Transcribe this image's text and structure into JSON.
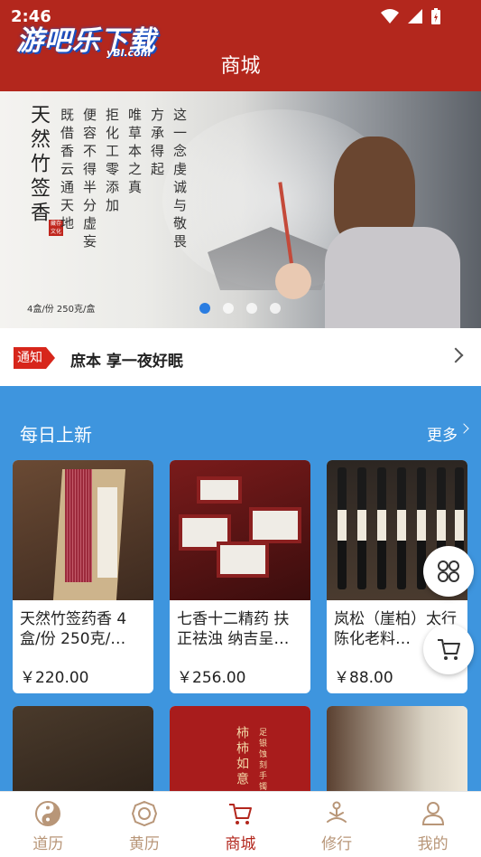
{
  "status_bar": {
    "time": "2:46"
  },
  "watermark": {
    "text": "游吧乐下载",
    "sub": "yBl.com"
  },
  "header": {
    "title": "商城"
  },
  "banner": {
    "title": "天然竹签香",
    "seal": "藏存文化",
    "poem_lines": [
      "这一念虔诚与敬畏",
      "方承得起",
      "唯草本之真",
      "拒化工零添加",
      "便容不得半分虚妄",
      "既借香云通天地"
    ],
    "caption": "4盒/份  250克/盒",
    "page_count": 4,
    "active_page": 1
  },
  "notice": {
    "tag": "通知",
    "text": "庶本  享一夜好眠"
  },
  "section": {
    "title": "每日上新",
    "more": "更多",
    "products": [
      {
        "name": "天然竹签药香 4盒/份 250克/…",
        "price": "￥220.00"
      },
      {
        "name": "七香十二精药 扶正祛浊 纳吉呈…",
        "price": "￥256.00"
      },
      {
        "name": "岚松（崖柏）太行陈化老料…",
        "price": "￥88.00"
      }
    ],
    "row2_text": "柿柿如意",
    "row2_sub": "足银蚀刻手镯"
  },
  "nav": [
    {
      "label": "道历",
      "icon": "yin-yang-icon"
    },
    {
      "label": "黄历",
      "icon": "bagua-icon"
    },
    {
      "label": "商城",
      "icon": "cart-icon",
      "active": true
    },
    {
      "label": "修行",
      "icon": "meditation-icon"
    },
    {
      "label": "我的",
      "icon": "user-icon"
    }
  ],
  "colors": {
    "header": "#B3271D",
    "section_bg": "#3E95DE",
    "nav_active": "#B3271D",
    "nav_inactive": "#B89678",
    "dot_active": "#2A7DE1"
  }
}
